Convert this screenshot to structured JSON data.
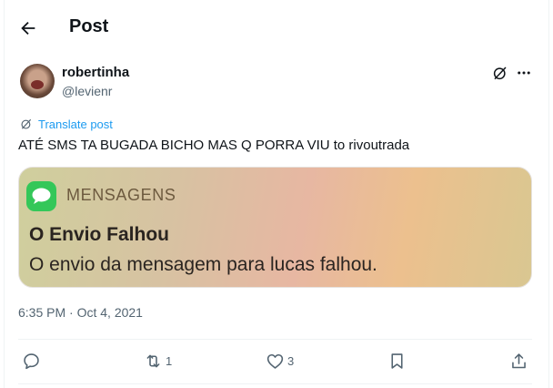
{
  "header": {
    "title": "Post",
    "back_icon": "arrow-left-icon"
  },
  "author": {
    "name": "robertinha",
    "handle": "@levienr",
    "avatar_icon": "user-avatar"
  },
  "tweet": {
    "translate_label": "Translate post",
    "text": "ATÉ SMS TA BUGADA BICHO MAS Q PORRA VIU to rivoutrada",
    "timestamp": "6:35 PM · Oct 4, 2021"
  },
  "media": {
    "app_label": "MENSAGENS",
    "title": "O Envio Falhou",
    "body": "O envio da mensagem para lucas falhou."
  },
  "actions": {
    "reply_count": "",
    "retweet_count": "1",
    "like_count": "3"
  },
  "colors": {
    "accent": "#1d9bf0",
    "text": "#0f1419",
    "secondary": "#536471",
    "messages_green": "#34c759"
  }
}
